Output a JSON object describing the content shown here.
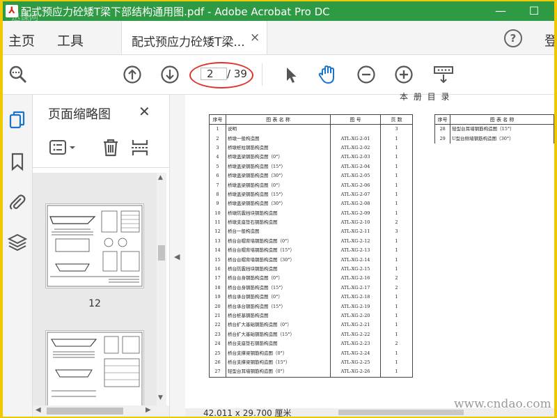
{
  "window": {
    "title": "配式预应力砼矮T梁下部结构通用图.pdf - Adobe Acrobat Pro DC",
    "watermark": "迅课网",
    "minimize_icon": "minimize-icon",
    "maximize_icon": "maximize-icon"
  },
  "tabs": {
    "home": "主页",
    "tools": "工具",
    "document_tab": "配式预应力砼矮T梁...",
    "close_symbol": "×",
    "help_symbol": "?",
    "login_partial": "登"
  },
  "toolbar": {
    "current_page": "2",
    "total_pages": "/ 39",
    "icons": [
      "zoom-icon",
      "page-up-icon",
      "page-down-icon",
      "select-arrow-icon",
      "hand-tool-icon",
      "zoom-out-icon",
      "zoom-in-icon",
      "scroll-mode-icon"
    ]
  },
  "sidebar": {
    "title": "页面缩略图",
    "close_symbol": "✕",
    "thumbnails": [
      {
        "label": "12"
      }
    ],
    "rail_icons": [
      "page-thumbnails-icon",
      "bookmark-icon",
      "attachment-icon",
      "layers-icon"
    ]
  },
  "document": {
    "heading": "本 册 目 录",
    "headers": [
      "序号",
      "图 表 名 称",
      "图 号",
      "页 数"
    ],
    "rows": [
      [
        "1",
        "说明",
        "",
        "3"
      ],
      [
        "2",
        "桥墩一般构造图",
        "ATL-XG-2-01",
        "1"
      ],
      [
        "3",
        "桥墩桩柱钢筋构造图",
        "ATL-XG-2-02",
        "1"
      ],
      [
        "4",
        "桥墩盖梁钢筋构造图（0°）",
        "ATL-XG-2-03",
        "1"
      ],
      [
        "5",
        "桥墩盖梁钢筋构造图（15°）",
        "ATL-XG-2-04",
        "1"
      ],
      [
        "6",
        "桥墩盖梁钢筋构造图（30°）",
        "ATL-XG-2-05",
        "1"
      ],
      [
        "7",
        "桥墩盖梁钢筋构造图（0°）",
        "ATL-XG-2-06",
        "1"
      ],
      [
        "8",
        "桥墩盖梁钢筋构造图（15°）",
        "ATL-XG-2-07",
        "1"
      ],
      [
        "9",
        "桥墩盖梁钢筋构造图（30°）",
        "ATL-XG-2-08",
        "1"
      ],
      [
        "10",
        "桥墩防震挡块钢筋构造图",
        "ATL-XG-2-09",
        "1"
      ],
      [
        "11",
        "桥墩支座垫石钢筋构造图",
        "ATL-XG-2-10",
        "2"
      ],
      [
        "12",
        "桥台一般构造图",
        "ATL-XG-2-11",
        "3"
      ],
      [
        "13",
        "桥台台帽背墙钢筋构造图（0°）",
        "ATL-XG-2-12",
        "1"
      ],
      [
        "14",
        "桥台台帽背墙钢筋构造图（15°）",
        "ATL-XG-2-13",
        "1"
      ],
      [
        "15",
        "桥台台帽背墙钢筋构造图（30°）",
        "ATL-XG-2-14",
        "1"
      ],
      [
        "16",
        "桥台防震挡块钢筋构造图",
        "ATL-XG-2-15",
        "1"
      ],
      [
        "17",
        "桥台台身钢筋构造图（0°）",
        "ATL-XG-2-16",
        "2"
      ],
      [
        "18",
        "桥台台身钢筋构造图（15°）",
        "ATL-XG-2-17",
        "2"
      ],
      [
        "19",
        "桥台承台钢筋构造图（0°）",
        "ATL-XG-2-18",
        "1"
      ],
      [
        "20",
        "桥台承台钢筋构造图（15°）",
        "ATL-XG-2-19",
        "1"
      ],
      [
        "21",
        "桥台桩基钢筋构造图",
        "ATL-XG-2-20",
        "1"
      ],
      [
        "22",
        "桥台扩大基础钢筋构造图（0°）",
        "ATL-XG-2-21",
        "1"
      ],
      [
        "23",
        "桥台扩大基础钢筋构造图（15°）",
        "ATL-XG-2-22",
        "1"
      ],
      [
        "24",
        "桥台支座垫石钢筋构造图",
        "ATL-XG-2-23",
        "2"
      ],
      [
        "25",
        "桥台支撑梁钢筋构造图（0°）",
        "ATL-XG-2-24",
        "1"
      ],
      [
        "26",
        "桥台支撑梁钢筋构造图（15°）",
        "ATL-XG-2-25",
        "1"
      ],
      [
        "27",
        "轻型台耳墙钢筋构造图（0°）",
        "ATL-XG-2-26",
        "1"
      ]
    ],
    "right_headers": [
      "序号",
      "图 表 名 称"
    ],
    "right_rows": [
      [
        "28",
        "轻型台耳墙钢筋构造图（15°）"
      ],
      [
        "29",
        "U型台侧墙钢筋构造图（30°）"
      ]
    ]
  },
  "status": {
    "page_size": "42.011 x 29.700 厘米",
    "watermark": "www.cndao.com"
  },
  "colors": {
    "titlebar": "#2e9a44",
    "frame_border": "#f0c800",
    "page_highlight": "#e0322c",
    "icon_blue": "#1a73c9"
  }
}
